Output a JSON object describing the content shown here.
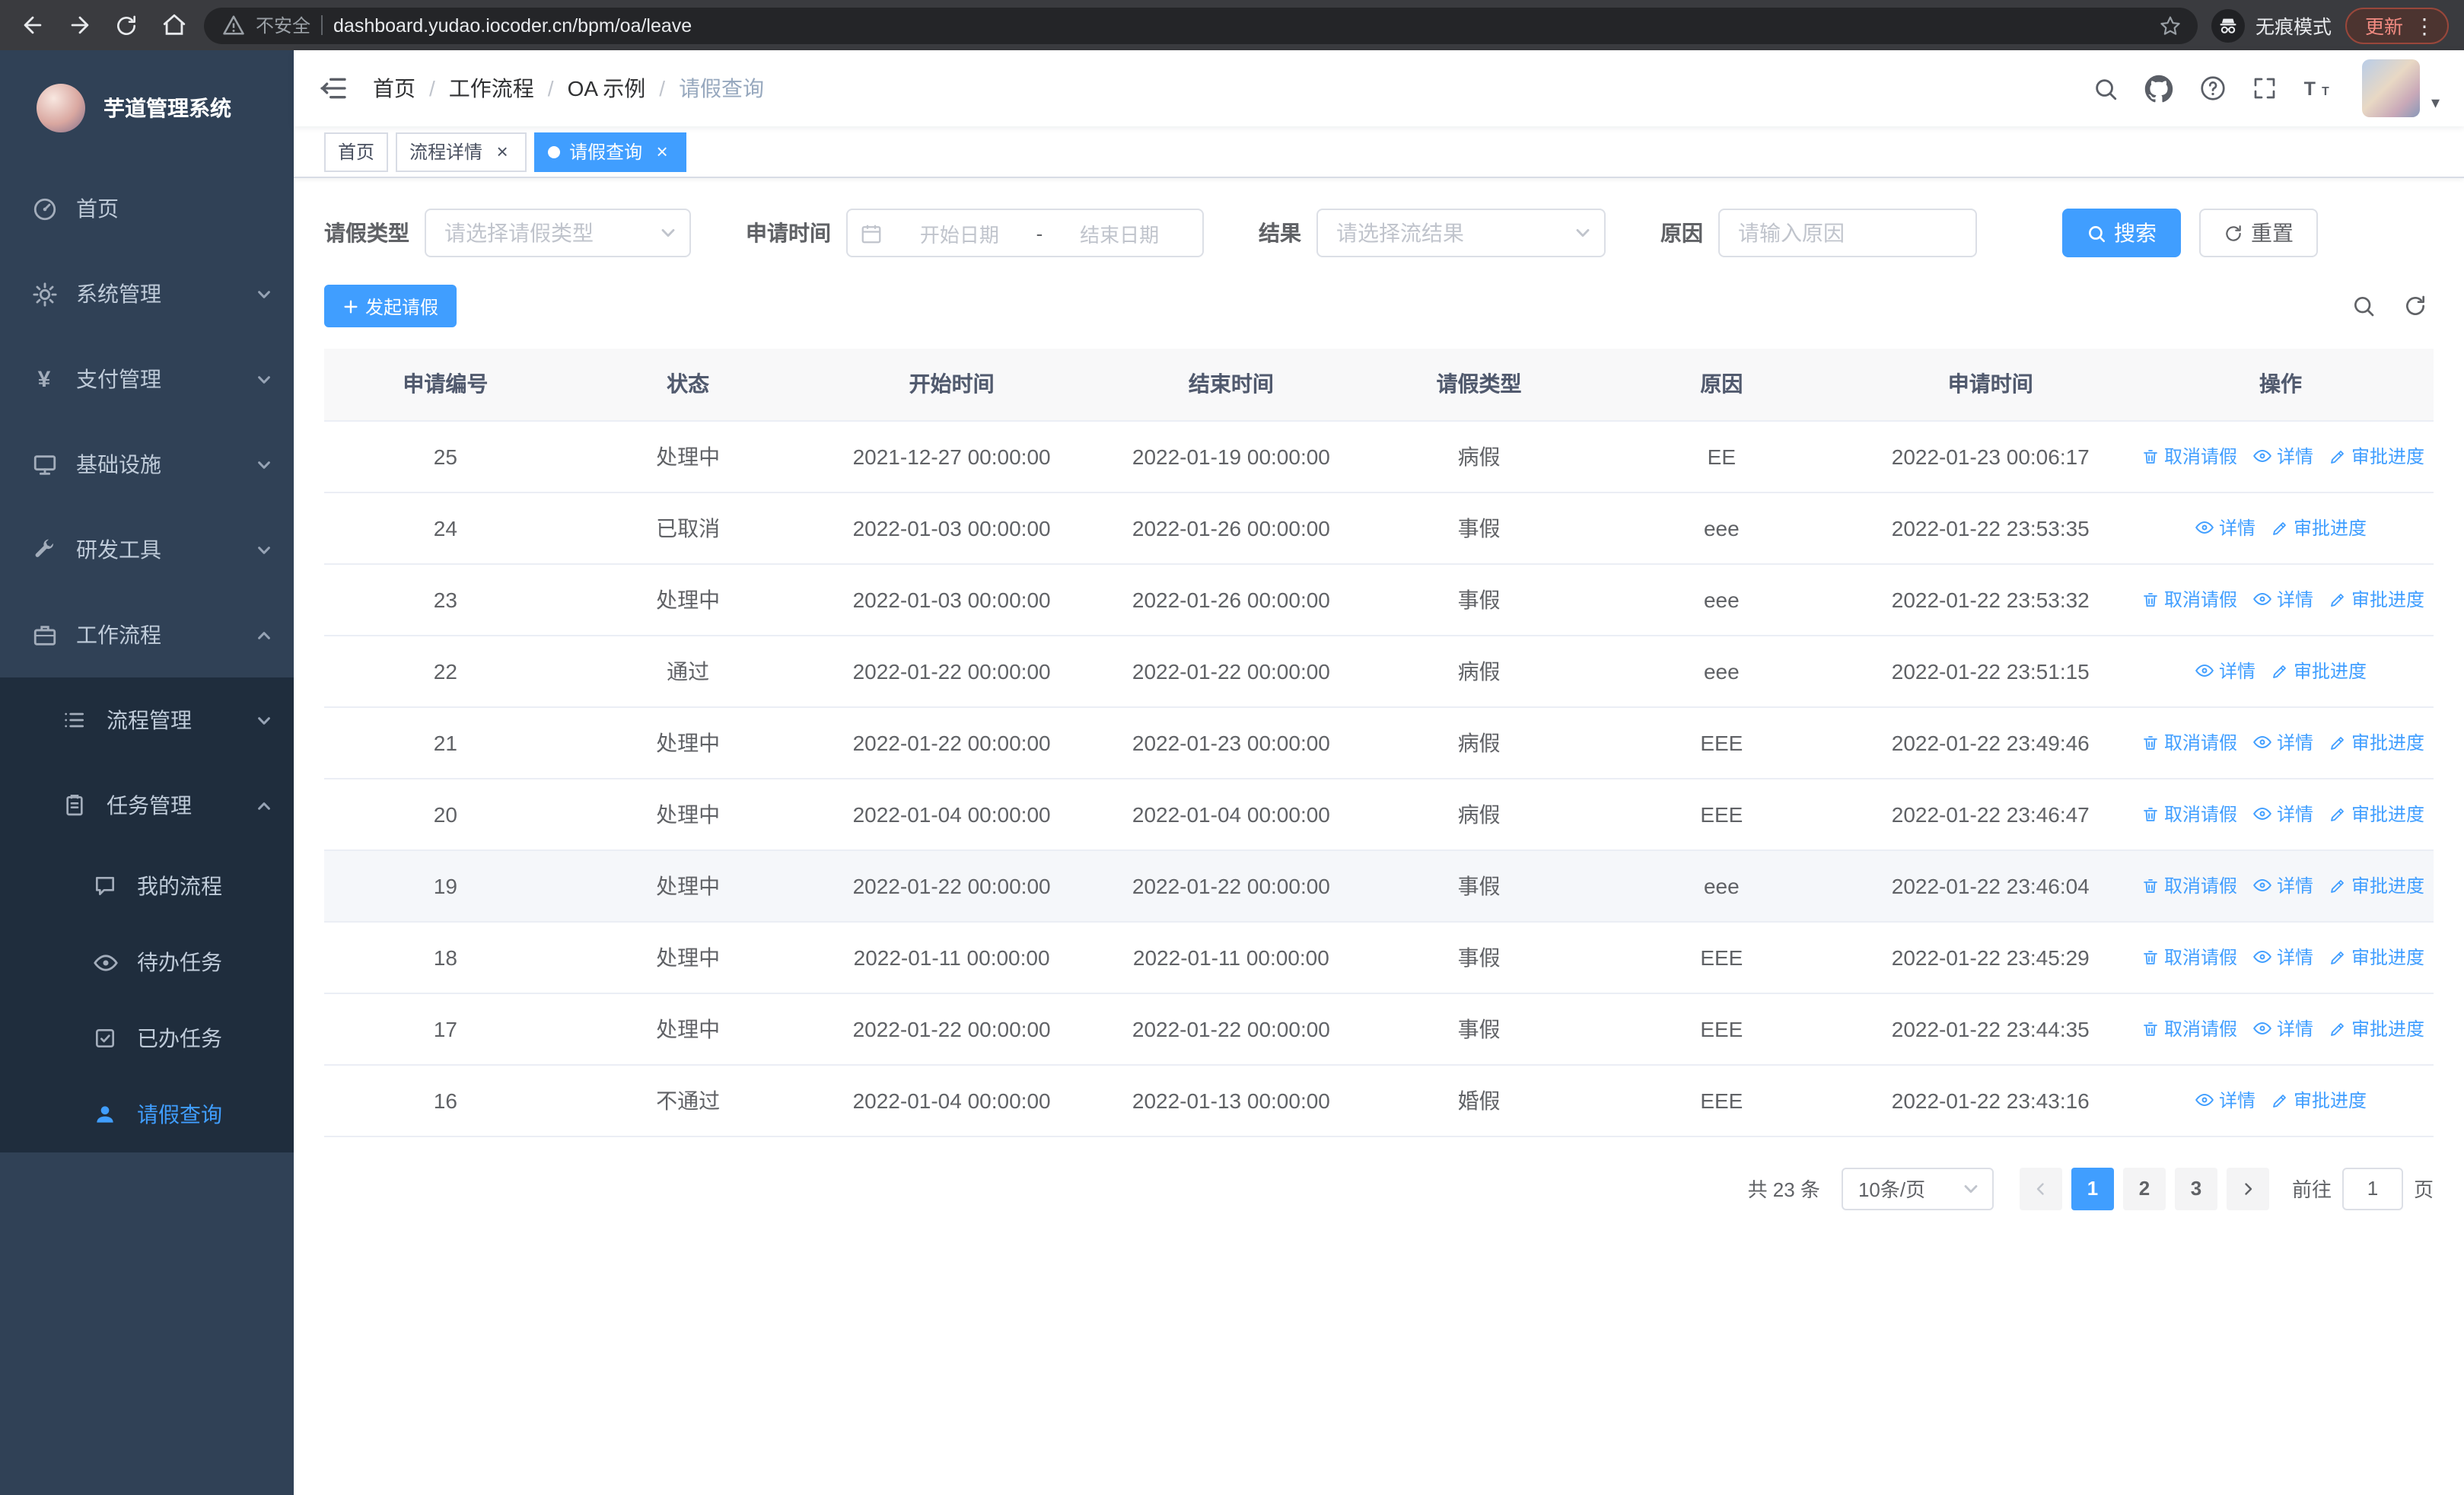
{
  "colors": {
    "primary": "#409EFF",
    "sidebar_bg": "#304156",
    "submenu_bg": "#1f2d3d"
  },
  "browser": {
    "security_label": "不安全",
    "url": "dashboard.yudao.iocoder.cn/bpm/oa/leave",
    "incognito_label": "无痕模式",
    "update_label": "更新"
  },
  "sidebar": {
    "logo_title": "芋道管理系统",
    "items": [
      {
        "label": "首页",
        "icon": "dashboard-icon"
      },
      {
        "label": "系统管理",
        "icon": "gear-icon",
        "expandable": true
      },
      {
        "label": "支付管理",
        "icon": "yen-icon",
        "expandable": true
      },
      {
        "label": "基础设施",
        "icon": "monitor-icon",
        "expandable": true
      },
      {
        "label": "研发工具",
        "icon": "wrench-icon",
        "expandable": true
      },
      {
        "label": "工作流程",
        "icon": "briefcase-icon",
        "expanded": true,
        "children": [
          {
            "label": "流程管理",
            "icon": "list-icon",
            "expandable": true
          },
          {
            "label": "任务管理",
            "icon": "clipboard-icon",
            "expanded": true,
            "children": [
              {
                "label": "我的流程",
                "icon": "chat-icon"
              },
              {
                "label": "待办任务",
                "icon": "eye-icon"
              },
              {
                "label": "已办任务",
                "icon": "check-square-icon"
              },
              {
                "label": "请假查询",
                "icon": "user-icon",
                "active": true
              }
            ]
          }
        ]
      }
    ]
  },
  "header": {
    "breadcrumb": [
      "首页",
      "工作流程",
      "OA 示例",
      "请假查询"
    ],
    "breadcrumb_separator": "/",
    "action_icons": [
      "search-icon",
      "github-icon",
      "question-icon",
      "fullscreen-icon",
      "font-size-icon",
      "avatar",
      "caret-down-icon"
    ]
  },
  "tabs": [
    {
      "label": "首页"
    },
    {
      "label": "流程详情",
      "closable": true
    },
    {
      "label": "请假查询",
      "closable": true,
      "active": true
    }
  ],
  "filters": {
    "leave_type_label": "请假类型",
    "leave_type_placeholder": "请选择请假类型",
    "apply_time_label": "申请时间",
    "start_date_placeholder": "开始日期",
    "range_separator": "-",
    "end_date_placeholder": "结束日期",
    "result_label": "结果",
    "result_placeholder": "请选择流结果",
    "reason_label": "原因",
    "reason_placeholder": "请输入原因",
    "search_button": "搜索",
    "reset_button": "重置"
  },
  "toolbar": {
    "create_button": "发起请假",
    "right_icons": [
      "search-toggle-icon",
      "refresh-icon"
    ]
  },
  "table": {
    "columns": [
      "申请编号",
      "状态",
      "开始时间",
      "结束时间",
      "请假类型",
      "原因",
      "申请时间",
      "操作"
    ],
    "op_labels": {
      "cancel": "取消请假",
      "detail": "详情",
      "progress": "审批进度"
    },
    "rows": [
      {
        "id": "25",
        "status": "处理中",
        "start": "2021-12-27 00:00:00",
        "end": "2022-01-19 00:00:00",
        "type": "病假",
        "reason": "EE",
        "apply_time": "2022-01-23 00:06:17",
        "ops": [
          "cancel",
          "detail",
          "progress"
        ]
      },
      {
        "id": "24",
        "status": "已取消",
        "start": "2022-01-03 00:00:00",
        "end": "2022-01-26 00:00:00",
        "type": "事假",
        "reason": "eee",
        "apply_time": "2022-01-22 23:53:35",
        "ops": [
          "detail",
          "progress"
        ]
      },
      {
        "id": "23",
        "status": "处理中",
        "start": "2022-01-03 00:00:00",
        "end": "2022-01-26 00:00:00",
        "type": "事假",
        "reason": "eee",
        "apply_time": "2022-01-22 23:53:32",
        "ops": [
          "cancel",
          "detail",
          "progress"
        ]
      },
      {
        "id": "22",
        "status": "通过",
        "start": "2022-01-22 00:00:00",
        "end": "2022-01-22 00:00:00",
        "type": "病假",
        "reason": "eee",
        "apply_time": "2022-01-22 23:51:15",
        "ops": [
          "detail",
          "progress"
        ]
      },
      {
        "id": "21",
        "status": "处理中",
        "start": "2022-01-22 00:00:00",
        "end": "2022-01-23 00:00:00",
        "type": "病假",
        "reason": "EEE",
        "apply_time": "2022-01-22 23:49:46",
        "ops": [
          "cancel",
          "detail",
          "progress"
        ]
      },
      {
        "id": "20",
        "status": "处理中",
        "start": "2022-01-04 00:00:00",
        "end": "2022-01-04 00:00:00",
        "type": "病假",
        "reason": "EEE",
        "apply_time": "2022-01-22 23:46:47",
        "ops": [
          "cancel",
          "detail",
          "progress"
        ]
      },
      {
        "id": "19",
        "status": "处理中",
        "start": "2022-01-22 00:00:00",
        "end": "2022-01-22 00:00:00",
        "type": "事假",
        "reason": "eee",
        "apply_time": "2022-01-22 23:46:04",
        "ops": [
          "cancel",
          "detail",
          "progress"
        ],
        "hovered": true
      },
      {
        "id": "18",
        "status": "处理中",
        "start": "2022-01-11 00:00:00",
        "end": "2022-01-11 00:00:00",
        "type": "事假",
        "reason": "EEE",
        "apply_time": "2022-01-22 23:45:29",
        "ops": [
          "cancel",
          "detail",
          "progress"
        ]
      },
      {
        "id": "17",
        "status": "处理中",
        "start": "2022-01-22 00:00:00",
        "end": "2022-01-22 00:00:00",
        "type": "事假",
        "reason": "EEE",
        "apply_time": "2022-01-22 23:44:35",
        "ops": [
          "cancel",
          "detail",
          "progress"
        ]
      },
      {
        "id": "16",
        "status": "不通过",
        "start": "2022-01-04 00:00:00",
        "end": "2022-01-13 00:00:00",
        "type": "婚假",
        "reason": "EEE",
        "apply_time": "2022-01-22 23:43:16",
        "ops": [
          "detail",
          "progress"
        ]
      }
    ]
  },
  "pagination": {
    "total_label": "共 23 条",
    "page_size": "10条/页",
    "pages": [
      "1",
      "2",
      "3"
    ],
    "active_page": "1",
    "goto_label": "前往",
    "goto_value": "1",
    "goto_suffix": "页"
  }
}
